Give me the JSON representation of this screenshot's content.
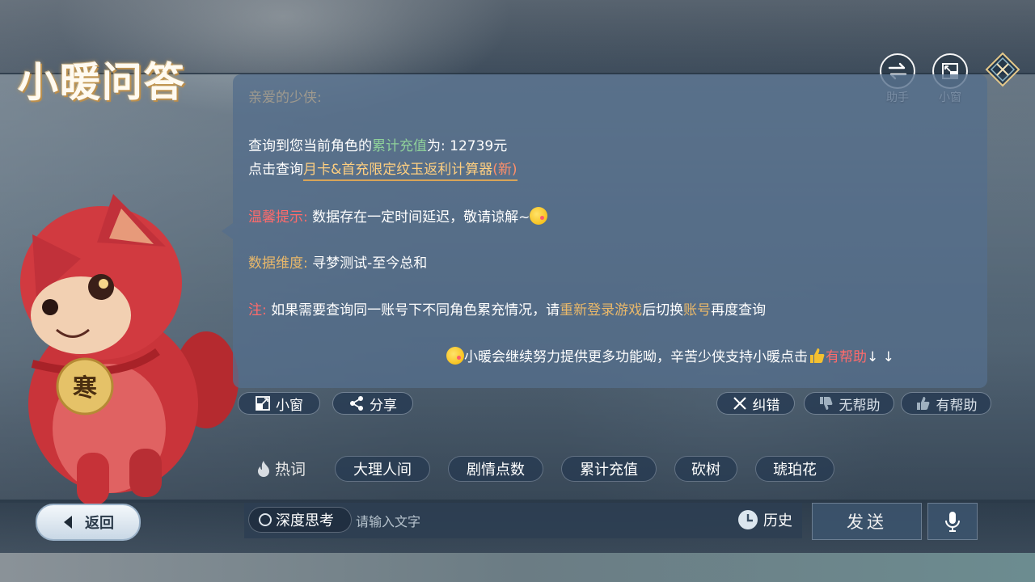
{
  "app": {
    "logo_text": "小暖问答"
  },
  "top_buttons": {
    "assistant": "助手",
    "mini_window": "小窗"
  },
  "message": {
    "greeting": "亲爱的少侠:",
    "line1_prefix": "查询到您当前角色的",
    "line1_highlight": "累计充值",
    "line1_suffix": "为: 12739元",
    "line2_prefix": "点击查询",
    "line2_link": "月卡&首充限定纹玉返利计算器",
    "line2_new": "(新)",
    "tip_label": "温馨提示:",
    "tip_text": "数据存在一定时间延迟，敬请谅解~",
    "dim_label": "数据维度:",
    "dim_text": "寻梦测试-至今总和",
    "note_label": "注:",
    "note_text1": "如果需要查询同一账号下不同角色累充情况，请",
    "note_highlight1": "重新登录游戏",
    "note_text2": "后切换",
    "note_highlight2": "账号",
    "note_text3": "再度查询",
    "footer_text": "小暖会继续努力提供更多功能呦，辛苦少侠支持小暖点击",
    "footer_helpful": "有帮助",
    "footer_arrows": "↓ ↓"
  },
  "actions": {
    "mini_window": "小窗",
    "share": "分享",
    "report": "纠错",
    "not_helpful": "无帮助",
    "helpful": "有帮助"
  },
  "hot": {
    "label": "热词",
    "chips": [
      "大理人间",
      "剧情点数",
      "累计充值",
      "砍树",
      "琥珀花"
    ]
  },
  "bottom": {
    "back": "返回",
    "deep_think": "深度思考",
    "input_placeholder": "请输入文字",
    "history": "历史",
    "send": "发送"
  },
  "mascot": {
    "badge_char": "寒"
  },
  "colors": {
    "green": "#8fd19a",
    "gold": "#e9b86a",
    "red": "#ff6b6b",
    "link": "#ffcf80"
  }
}
